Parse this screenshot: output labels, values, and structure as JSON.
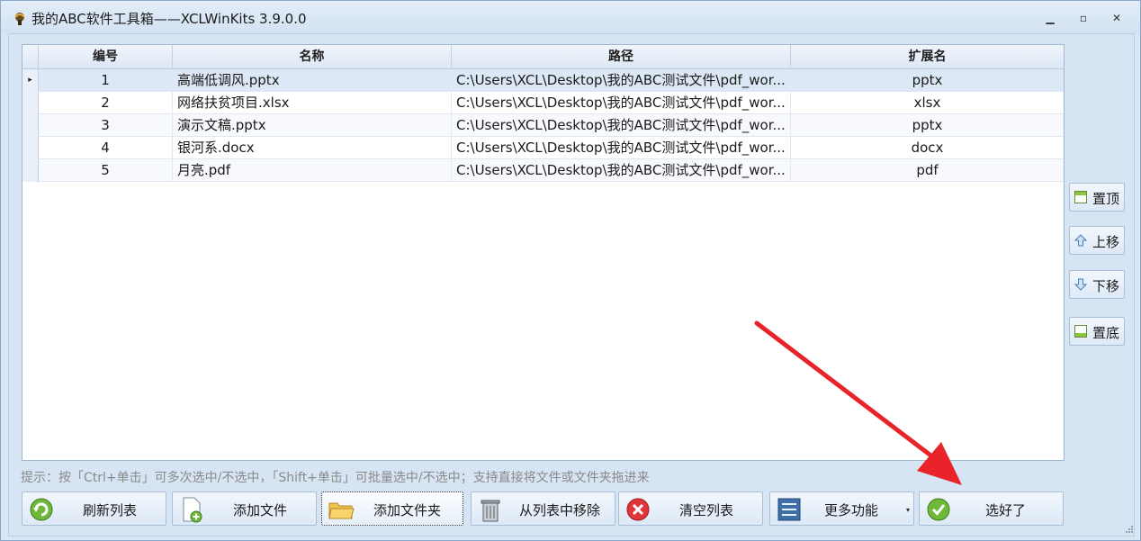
{
  "window": {
    "title": "我的ABC软件工具箱——XCLWinKits  3.9.0.0",
    "min_glyph": "▁",
    "max_glyph": "▫",
    "close_glyph": "✕"
  },
  "grid": {
    "columns": [
      "编号",
      "名称",
      "路径",
      "扩展名"
    ],
    "selected_row_marker": "▸",
    "rows": [
      {
        "no": "1",
        "name": "高端低调风.pptx",
        "path": "C:\\Users\\XCL\\Desktop\\我的ABC测试文件\\pdf_wor...",
        "ext": "pptx"
      },
      {
        "no": "2",
        "name": "网络扶贫项目.xlsx",
        "path": "C:\\Users\\XCL\\Desktop\\我的ABC测试文件\\pdf_wor...",
        "ext": "xlsx"
      },
      {
        "no": "3",
        "name": "演示文稿.pptx",
        "path": "C:\\Users\\XCL\\Desktop\\我的ABC测试文件\\pdf_wor...",
        "ext": "pptx"
      },
      {
        "no": "4",
        "name": "银河系.docx",
        "path": "C:\\Users\\XCL\\Desktop\\我的ABC测试文件\\pdf_wor...",
        "ext": "docx"
      },
      {
        "no": "5",
        "name": "月亮.pdf",
        "path": "C:\\Users\\XCL\\Desktop\\我的ABC测试文件\\pdf_wor...",
        "ext": "pdf"
      }
    ]
  },
  "hint": "提示：按「Ctrl+单击」可多次选中/不选中，「Shift+单击」可批量选中/不选中；支持直接将文件或文件夹拖进来",
  "side_buttons": {
    "top": "置顶",
    "up": "上移",
    "down": "下移",
    "bottom": "置底"
  },
  "bottom_buttons": {
    "refresh": "刷新列表",
    "add_file": "添加文件",
    "add_folder": "添加文件夹",
    "remove": "从列表中移除",
    "clear": "清空列表",
    "more": "更多功能",
    "more_arrow": "▾",
    "done": "选好了"
  },
  "colors": {
    "accent_arrow": "#e8232a",
    "header_bg": "#dde8f5",
    "window_bg": "#d6e4f3"
  }
}
